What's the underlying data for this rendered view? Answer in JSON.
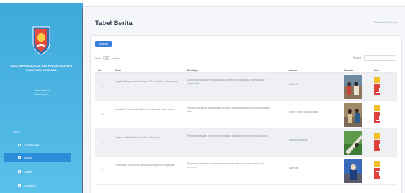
{
  "sidebar": {
    "org_name": "DINAS KEPENDUDUKAN DAN PENCATATAN SIPIL KABUPATEN SUMBAWA",
    "user_name": "Admin Berita",
    "user_role": "Admin_dkb",
    "menu_header": "Menu",
    "menu": [
      {
        "label": "Dashboard",
        "active": false
      },
      {
        "label": "Berita",
        "active": true
      },
      {
        "label": "Galeri",
        "active": false
      },
      {
        "label": "Kategori",
        "active": false
      }
    ]
  },
  "header": {
    "title": "Tabel Berita",
    "breadcrumb": "Dashboard / Berita"
  },
  "toolbar": {
    "add_label": "Tambah",
    "show_label": "Show",
    "show_value": "10",
    "entries_label": "entries",
    "search_label": "Search:"
  },
  "table": {
    "columns": [
      "No",
      "Judul",
      "Deskripsi",
      "Alamat",
      "Gambar",
      "Aksi"
    ],
    "rows": [
      {
        "no": "1",
        "title": "Kegiatan Pelayanan Perekaman KTP-el Keliling di Kecamatan",
        "desc": "Dinas Kependudukan melaksanakan pelayanan keliling untuk memudahkan masyarakat",
        "loc": "Lab Kota"
      },
      {
        "no": "2",
        "title": "Sosialisasi Pemanfaatan Data Kependudukan bagi Instansi",
        "desc": "Kegiatan sosialisasi dilaksanakan bersama perangkat daerah guna pemanfaatan data",
        "loc": "Kantor Dinas Kependudukan"
      },
      {
        "no": "3",
        "title": "Pelayanan Akta Kelahiran di Desa Terpencil",
        "desc": "Petugas melakukan jemput bola pelayanan administrasi kependudukan di desa",
        "loc": "Desa Lenangguar"
      },
      {
        "no": "4",
        "title": "Penyerahan Dokumen Kependudukan kepada Masyarakat",
        "desc": "Penyerahan dokumen kependudukan secara langsung kepada masyarakat penerima",
        "loc": "Lab Kota"
      }
    ]
  },
  "colors": {
    "sidebar_bg": "#3fa9dc",
    "active_menu": "#2c8ed8",
    "primary": "#3c7fd8",
    "edit": "#f4c021",
    "delete": "#e0413e"
  },
  "icons": {
    "logo": "regency-emblem",
    "edit": "pencil-icon",
    "delete": "trash-icon"
  }
}
